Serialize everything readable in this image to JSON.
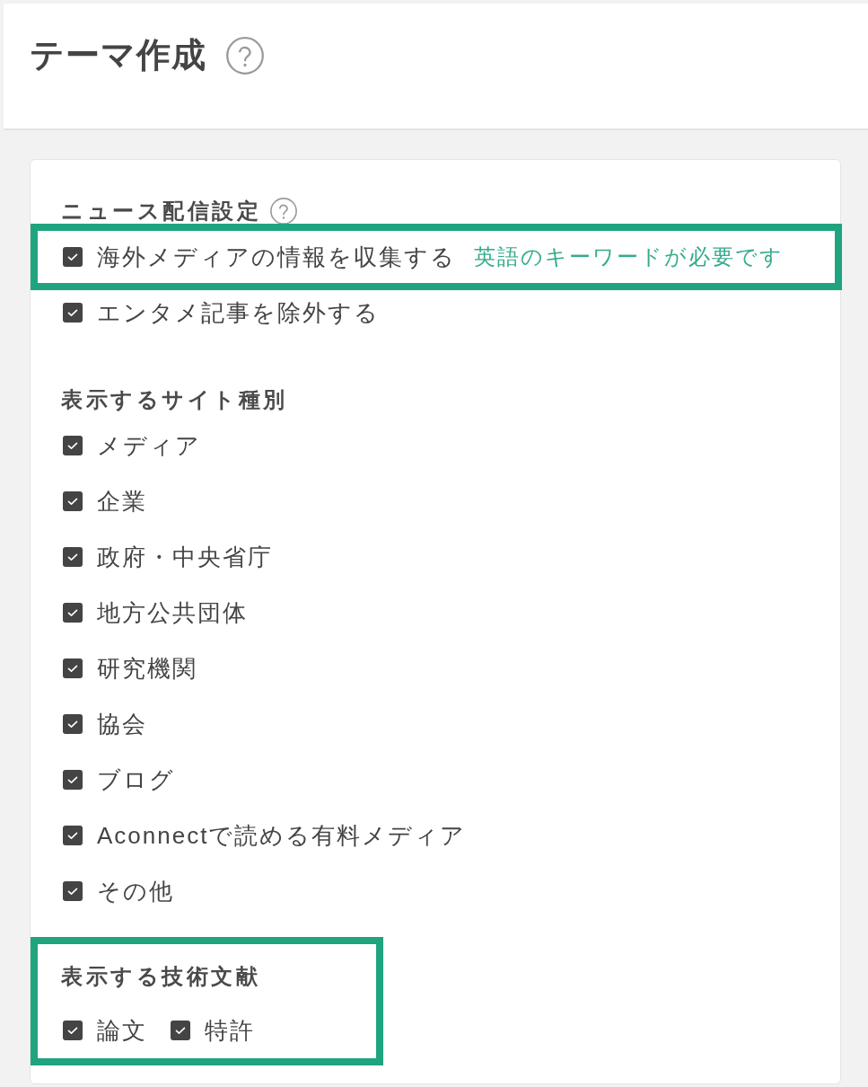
{
  "header": {
    "title": "テーマ作成",
    "help": true
  },
  "sections": [
    {
      "kind": "list",
      "title": "ニュース配信設定",
      "help": true,
      "items": [
        {
          "label": "海外メディアの情報を収集する",
          "note": "英語のキーワードが必要です",
          "checked": true,
          "highlighted": true
        },
        {
          "label": "エンタメ記事を除外する",
          "checked": true
        }
      ]
    },
    {
      "kind": "list",
      "title": "表示するサイト種別",
      "items": [
        {
          "label": "メディア",
          "checked": true
        },
        {
          "label": "企業",
          "checked": true
        },
        {
          "label": "政府・中央省庁",
          "checked": true
        },
        {
          "label": "地方公共団体",
          "checked": true
        },
        {
          "label": "研究機関",
          "checked": true
        },
        {
          "label": "協会",
          "checked": true
        },
        {
          "label": "ブログ",
          "checked": true
        },
        {
          "label": "Aconnectで読める有料メディア",
          "checked": true
        },
        {
          "label": "その他",
          "checked": true
        }
      ]
    },
    {
      "kind": "inline",
      "title": "表示する技術文献",
      "highlighted": true,
      "items": [
        {
          "label": "論文",
          "checked": true
        },
        {
          "label": "特許",
          "checked": true
        }
      ]
    }
  ]
}
